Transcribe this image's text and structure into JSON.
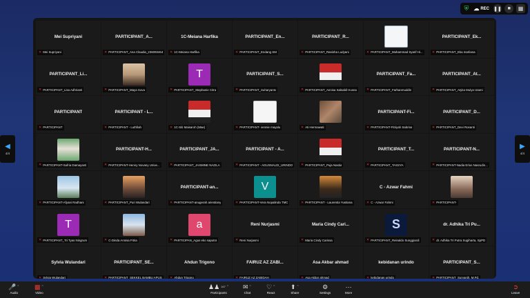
{
  "top_bar": {
    "rec_label": "REC",
    "shield_icon": "shield-icon",
    "pause_icon": "pause-icon",
    "stop_icon": "stop-icon",
    "grid_icon": "grid-icon"
  },
  "nav": {
    "page_left": "4/4",
    "page_right": "4/4"
  },
  "participants": [
    {
      "big": "Mei Supriyani",
      "label": "Mei Supriyani",
      "type": "name"
    },
    {
      "big": "PARTICIPANT_A...",
      "label": "PARTICIPANT_Ana Claudia_236093464",
      "type": "name"
    },
    {
      "big": "1C-Meiana Harfika",
      "label": "1C-Meiana Harfika",
      "type": "name"
    },
    {
      "big": "PARTICIPANT_En...",
      "label": "PARTICIPANT_Endang SM",
      "type": "name"
    },
    {
      "big": "PARTICIPANT_R...",
      "label": "PARTICIPANT_Ranisha Ludyani",
      "type": "name"
    },
    {
      "big": "",
      "label": "PARTICIPANT_Muhammad Syarif Hi...",
      "type": "photo",
      "photo": "doc"
    },
    {
      "big": "PARTICIPANT_Ek...",
      "label": "PARTICIPANT_Eka marliana",
      "type": "name"
    },
    {
      "big": "PARTICIPANT_Li...",
      "label": "PARTICIPANT_Lisa Adhrianti",
      "type": "name"
    },
    {
      "big": "",
      "label": "PARTICIPANT_Maya Sova",
      "type": "photo",
      "photo": "person-light"
    },
    {
      "big": "T",
      "label": "PARTICIPANT_Stephanie Citra",
      "type": "letter",
      "color": "#9b2bb5"
    },
    {
      "big": "PARTICIPANT_S...",
      "label": "PARTICIPANT_Suharyanto",
      "type": "name"
    },
    {
      "big": "",
      "label": "PARTICIPANT_Annisa Salsabil Husna",
      "type": "photo",
      "photo": "person-red"
    },
    {
      "big": "PARTICIPANT_Fa...",
      "label": "PARTICIPANT_Farhanmuddin",
      "type": "name"
    },
    {
      "big": "PARTICIPANT_At...",
      "label": "PARTICIPANT_Atyka Mulya Utami",
      "type": "name"
    },
    {
      "big": "PARTICIPANT",
      "label": "PARTICIPANT",
      "type": "name"
    },
    {
      "big": "PARTICIPANT - L...",
      "label": "PARTICIPANT - Luthfiah",
      "type": "name"
    },
    {
      "big": "",
      "label": "1C-Siti Maisaroh (Mae)",
      "type": "photo",
      "photo": "person-red"
    },
    {
      "big": "",
      "label": "PARTICIPANT- vennie mayalu",
      "type": "photo",
      "photo": "white"
    },
    {
      "big": "",
      "label": "Ati Hermawati",
      "type": "photo",
      "photo": "group"
    },
    {
      "big": "PARTICIPANT-Fi...",
      "label": "PARTICIPANT-Fitriyah Sabrina",
      "type": "name"
    },
    {
      "big": "PARTICIPANT_D...",
      "label": "PARTICIPANT_Devi Rosanti",
      "type": "name"
    },
    {
      "big": "",
      "label": "PARTICIPANT-Sufria Damayanti",
      "type": "photo",
      "photo": "person-green"
    },
    {
      "big": "PARTICIPANT-H...",
      "label": "PARTICIPANT-Henny Novany Unive...",
      "type": "name"
    },
    {
      "big": "PARTICIPANT_JA...",
      "label": "PARTICIPANT_JASMINE NAZILA",
      "type": "name"
    },
    {
      "big": "PARTICIPANT - A...",
      "label": "PARTICIPANT - AGUSNALDI_URINDO",
      "type": "name"
    },
    {
      "big": "",
      "label": "PARTICIPANT_Puja Nastia",
      "type": "photo",
      "photo": "person-red"
    },
    {
      "big": "PARTICIPANT_T...",
      "label": "PARTICIPANT_TASSYA",
      "type": "name"
    },
    {
      "big": "PARTICIPANT-N...",
      "label": "PARTICIPANT-Nadia Erlus Nasrudin...",
      "type": "name"
    },
    {
      "big": "",
      "label": "PARTICIPANT-Afyani Radhani",
      "type": "photo",
      "photo": "lake"
    },
    {
      "big": "",
      "label": "PARTICIPANT_Puri Wulandari",
      "type": "photo",
      "photo": "sunset"
    },
    {
      "big": "PARTICIPANT-an...",
      "label": "PARTICIPANT-anugerah ariestiany",
      "type": "name"
    },
    {
      "big": "V",
      "label": "PARTICIPANT-Vera Nopalinda TMC",
      "type": "letter",
      "color": "#0b8f8f"
    },
    {
      "big": "",
      "label": "PARTICIPANT - Laurentia Yustiana",
      "type": "photo",
      "photo": "person-orange"
    },
    {
      "big": "C - Azwar Fahmi",
      "label": "C - Azwar Fahmi",
      "type": "name"
    },
    {
      "big": "",
      "label": "PARTICIPANT-",
      "type": "photo",
      "photo": "person-beige"
    },
    {
      "big": "T",
      "label": "PARTICIPANT_Tri Tyas Ningrum",
      "type": "letter",
      "color": "#9b2bb5"
    },
    {
      "big": "",
      "label": "C-Dinda Annisa Fitria",
      "type": "photo",
      "photo": "sky"
    },
    {
      "big": "a",
      "label": "PARTICIPAN_Agus eko saputra",
      "type": "letter",
      "color": "#e0476e"
    },
    {
      "big": "Reni Nurjasmi",
      "label": "Reni Nurjasmi",
      "type": "name"
    },
    {
      "big": "Maria Cindy Cari...",
      "label": "Maria Cindy Carissa",
      "type": "name"
    },
    {
      "big": "",
      "label": "PARTICIPANT_Reinaldo Sunggiardi",
      "type": "photo",
      "photo": "logo"
    },
    {
      "big": "dr. Adhika Tri Pu...",
      "label": "dr. Adhika Tri Putra Sugiharta, SpPD",
      "type": "name"
    },
    {
      "big": "Sylvia Wulandari",
      "label": "Sylvia Wulandari",
      "type": "name"
    },
    {
      "big": "PARTICIPANT_SE...",
      "label": "PARTICIPANT_SEKKEL BAMBU APUS",
      "type": "name"
    },
    {
      "big": "Ahdun Trigono",
      "label": "Ahdun Trigono",
      "type": "name"
    },
    {
      "big": "FAIRUZ AZ ZABI...",
      "label": "FAIRUZ AZ ZABIDAH",
      "type": "name"
    },
    {
      "big": "Asa Akbar ahmad",
      "label": "Asa Akbar ahmad",
      "type": "name"
    },
    {
      "big": "kebidanan urindo",
      "label": "kebidanan urindo",
      "type": "name"
    },
    {
      "big": "PARTICIPANT_S...",
      "label": "PARTICIPANT_Suryanih, M.Pd.",
      "type": "name"
    }
  ],
  "toolbar": {
    "audio": "Audio",
    "video": "Video",
    "participants": "Participants",
    "participants_count": "167",
    "chat": "Chat",
    "react": "React",
    "share": "Share",
    "settings": "Settings",
    "more": "More",
    "leave": "Leave"
  },
  "colors": {
    "mute": "#e53935",
    "accent": "#3da7ff",
    "leave": "#e53935"
  }
}
